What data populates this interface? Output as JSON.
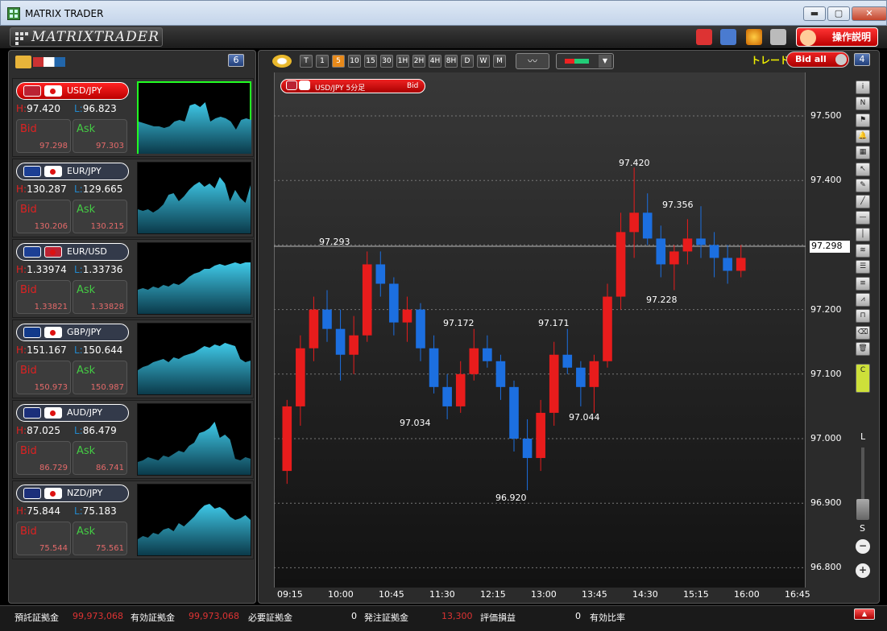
{
  "window": {
    "title": "MATRIX TRADER",
    "min": "▬",
    "max": "▢",
    "close": "✕"
  },
  "toolbar": {
    "brand": "MATRIXTRADER",
    "help": "操作説明",
    "icons": [
      "toolbox-icon",
      "save-icon",
      "palette-icon",
      "print-icon"
    ]
  },
  "left": {
    "count": "6"
  },
  "pairs": [
    {
      "name": "USD/JPY",
      "active": true,
      "h": "97.420",
      "l": "96.823",
      "bid_main": "97.29",
      "bid_small": "8",
      "ask_main": "97.30",
      "ask_small": "3",
      "flags": [
        "#b23",
        "#fff"
      ]
    },
    {
      "name": "EUR/JPY",
      "active": false,
      "h": "130.287",
      "l": "129.665",
      "bid_main": "130.20",
      "bid_small": "6",
      "ask_main": "130.21",
      "ask_small": "5",
      "flags": [
        "#1c3f94",
        "#fff"
      ]
    },
    {
      "name": "EUR/USD",
      "active": false,
      "h": "1.33974",
      "l": "1.33736",
      "bid_main": "1.3382",
      "bid_small": "1",
      "ask_main": "1.3382",
      "ask_small": "8",
      "flags": [
        "#1c3f94",
        "#b23"
      ]
    },
    {
      "name": "GBP/JPY",
      "active": false,
      "h": "151.167",
      "l": "150.644",
      "bid_main": "150.97",
      "bid_small": "3",
      "ask_main": "150.98",
      "ask_small": "7",
      "flags": [
        "#123a8a",
        "#fff"
      ]
    },
    {
      "name": "AUD/JPY",
      "active": false,
      "h": "87.025",
      "l": "86.479",
      "bid_main": "86.72",
      "bid_small": "9",
      "ask_main": "86.74",
      "ask_small": "1",
      "flags": [
        "#1b2f7a",
        "#fff"
      ]
    },
    {
      "name": "NZD/JPY",
      "active": false,
      "h": "75.844",
      "l": "75.183",
      "bid_main": "75.54",
      "bid_small": "4",
      "ask_main": "75.56",
      "ask_small": "1",
      "flags": [
        "#1b2f7a",
        "#fff"
      ]
    }
  ],
  "labels": {
    "h": "H:",
    "l": "L:",
    "bid": "Bid",
    "ask": "Ask"
  },
  "chart": {
    "timeframes": [
      "T",
      "1",
      "5",
      "10",
      "15",
      "30",
      "1H",
      "2H",
      "4H",
      "8H",
      "D",
      "W",
      "M"
    ],
    "active_tf": "5",
    "trade": "トレード",
    "toggle": "Bid all",
    "count": "4",
    "legend": "USD/JPY 5分足",
    "legend_side": "Bid",
    "current_price": "97.298",
    "yticks": [
      "97.500",
      "97.400",
      "97.300",
      "97.200",
      "97.100",
      "97.000",
      "96.900",
      "96.800"
    ],
    "xticks": [
      "09:15",
      "10:00",
      "10:45",
      "11:30",
      "12:15",
      "13:00",
      "13:45",
      "14:30",
      "15:15",
      "16:00",
      "16:45"
    ],
    "annotations": [
      "97.293",
      "97.034",
      "97.172",
      "96.920",
      "97.171",
      "97.044",
      "97.420",
      "97.356",
      "97.228"
    ],
    "zoom_top": "L",
    "zoom_bottom": "S",
    "up_color": "#e81c1c",
    "down_color": "#1c6fe0"
  },
  "chart_data": {
    "type": "candlestick",
    "title": "USD/JPY 5分足",
    "ylim": [
      96.78,
      97.55
    ],
    "candles": [
      [
        96.95,
        97.06,
        96.93,
        97.05
      ],
      [
        97.05,
        97.16,
        97.02,
        97.14
      ],
      [
        97.14,
        97.22,
        97.12,
        97.2
      ],
      [
        97.2,
        97.23,
        97.15,
        97.17
      ],
      [
        97.17,
        97.2,
        97.09,
        97.13
      ],
      [
        97.13,
        97.19,
        97.1,
        97.16
      ],
      [
        97.16,
        97.29,
        97.15,
        97.27
      ],
      [
        97.27,
        97.29,
        97.22,
        97.24
      ],
      [
        97.24,
        97.25,
        97.16,
        97.18
      ],
      [
        97.18,
        97.22,
        97.15,
        97.2
      ],
      [
        97.2,
        97.21,
        97.12,
        97.14
      ],
      [
        97.14,
        97.16,
        97.07,
        97.08
      ],
      [
        97.08,
        97.1,
        97.03,
        97.05
      ],
      [
        97.05,
        97.12,
        97.04,
        97.1
      ],
      [
        97.1,
        97.17,
        97.09,
        97.14
      ],
      [
        97.14,
        97.16,
        97.11,
        97.12
      ],
      [
        97.12,
        97.13,
        97.06,
        97.08
      ],
      [
        97.08,
        97.09,
        96.98,
        97.0
      ],
      [
        97.0,
        97.03,
        96.92,
        96.97
      ],
      [
        96.97,
        97.06,
        96.95,
        97.04
      ],
      [
        97.04,
        97.15,
        97.02,
        97.13
      ],
      [
        97.13,
        97.17,
        97.1,
        97.11
      ],
      [
        97.11,
        97.12,
        97.05,
        97.08
      ],
      [
        97.08,
        97.13,
        97.04,
        97.12
      ],
      [
        97.12,
        97.24,
        97.11,
        97.22
      ],
      [
        97.22,
        97.35,
        97.2,
        97.32
      ],
      [
        97.32,
        97.42,
        97.28,
        97.35
      ],
      [
        97.35,
        97.38,
        97.3,
        97.31
      ],
      [
        97.31,
        97.33,
        97.25,
        97.27
      ],
      [
        97.27,
        97.3,
        97.23,
        97.29
      ],
      [
        97.29,
        97.34,
        97.27,
        97.31
      ],
      [
        97.31,
        97.36,
        97.28,
        97.3
      ],
      [
        97.3,
        97.32,
        97.25,
        97.28
      ],
      [
        97.28,
        97.3,
        97.24,
        97.26
      ],
      [
        97.26,
        97.3,
        97.25,
        97.28
      ]
    ]
  },
  "bottom": [
    {
      "label": "預託証拠金",
      "value": "99,973,068"
    },
    {
      "label": "有効証拠金",
      "value": "99,973,068"
    },
    {
      "label": "必要証拠金",
      "value": "0"
    },
    {
      "label": "発注証拠金",
      "value": "13,300"
    },
    {
      "label": "評価損益",
      "value": "0"
    },
    {
      "label": "有効比率",
      "value": ""
    }
  ]
}
